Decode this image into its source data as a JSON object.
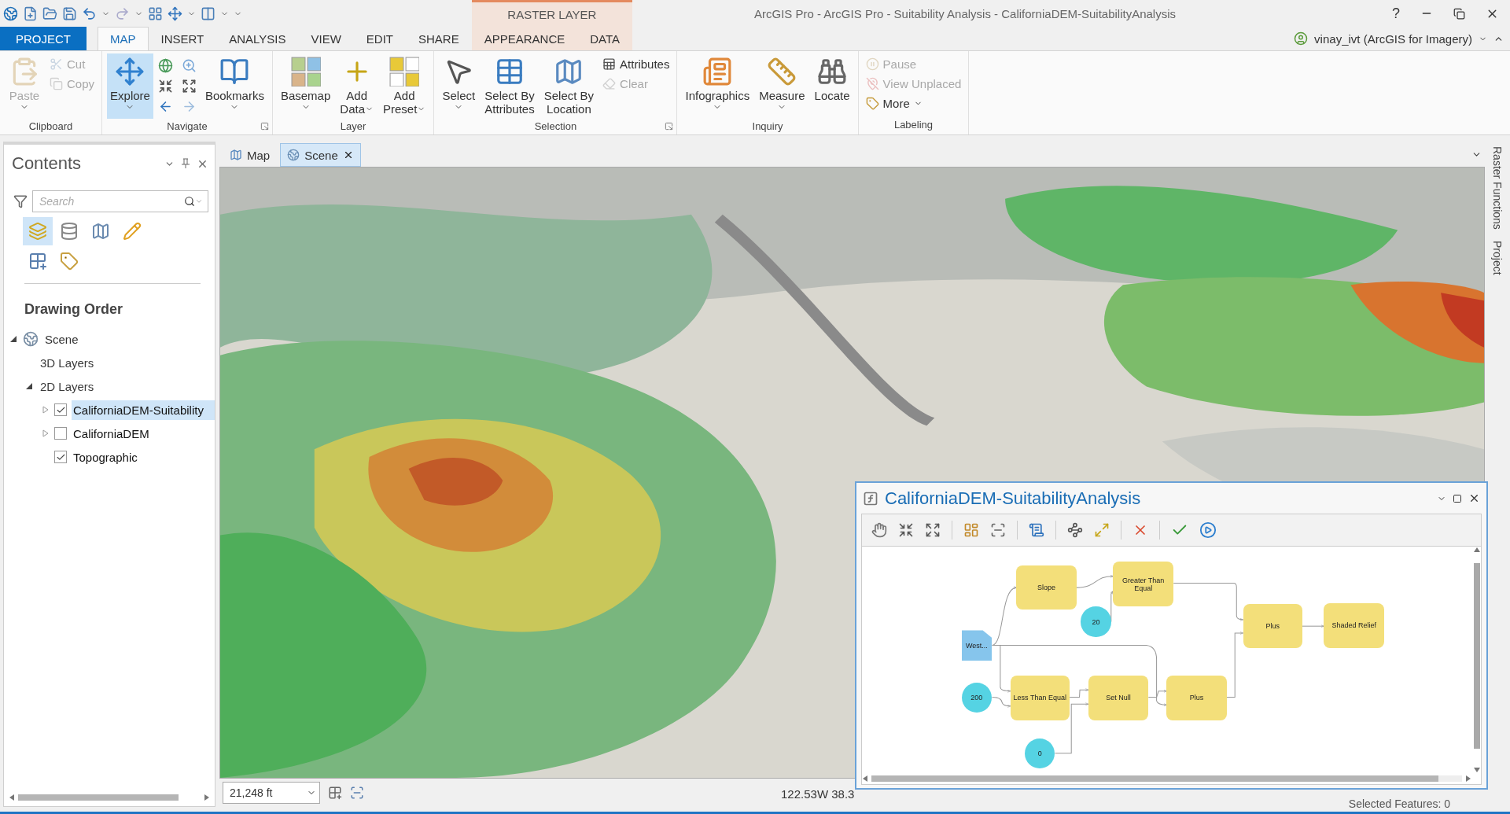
{
  "title_bar": {
    "title": "ArcGIS Pro - ArcGIS Pro - Suitability Analysis - CaliforniaDEM-SuitabilityAnalysis",
    "help": "?",
    "context_label": "RASTER LAYER"
  },
  "tabs": [
    {
      "label": "PROJECT",
      "kind": "backstage",
      "selected": false
    },
    {
      "label": "MAP",
      "kind": "core",
      "selected": true
    },
    {
      "label": "INSERT",
      "kind": "core",
      "selected": false
    },
    {
      "label": "ANALYSIS",
      "kind": "core",
      "selected": false
    },
    {
      "label": "VIEW",
      "kind": "core",
      "selected": false
    },
    {
      "label": "EDIT",
      "kind": "core",
      "selected": false
    },
    {
      "label": "SHARE",
      "kind": "core",
      "selected": false
    },
    {
      "label": "APPEARANCE",
      "kind": "contextual",
      "selected": false
    },
    {
      "label": "DATA",
      "kind": "contextual",
      "selected": false
    }
  ],
  "user": "vinay_ivt (ArcGIS for Imagery)",
  "ribbon": {
    "groups": [
      {
        "label": "Clipboard",
        "launcher": false,
        "items": [
          {
            "kind": "large",
            "lines": [
              "Paste"
            ],
            "dropdown": true,
            "disabled": true,
            "active": false
          },
          {
            "kind": "small",
            "lines": [
              "Cut"
            ],
            "disabled": true,
            "active": false
          },
          {
            "kind": "small",
            "lines": [
              "Copy"
            ],
            "disabled": true,
            "active": false
          }
        ]
      },
      {
        "label": "Navigate",
        "launcher": true,
        "items": [
          {
            "kind": "large",
            "lines": [
              "Explore"
            ],
            "dropdown": true,
            "disabled": false,
            "active": true
          },
          {
            "kind": "icon",
            "disabled": false,
            "active": false
          },
          {
            "kind": "icon",
            "disabled": false,
            "active": false
          },
          {
            "kind": "icon",
            "disabled": false,
            "active": false
          },
          {
            "kind": "icon",
            "disabled": false,
            "active": false
          },
          {
            "kind": "icon",
            "disabled": false,
            "active": false
          },
          {
            "kind": "icon",
            "disabled": true,
            "active": false
          },
          {
            "kind": "large",
            "lines": [
              "Bookmarks"
            ],
            "dropdown": true,
            "disabled": false,
            "active": false
          }
        ]
      },
      {
        "label": "Layer",
        "launcher": false,
        "items": [
          {
            "kind": "large",
            "lines": [
              "Basemap"
            ],
            "dropdown": true,
            "disabled": false,
            "active": false
          },
          {
            "kind": "large",
            "lines": [
              "Add",
              "Data"
            ],
            "dropdown": true,
            "disabled": false,
            "active": false
          },
          {
            "kind": "large",
            "lines": [
              "Add",
              "Preset"
            ],
            "dropdown": true,
            "disabled": false,
            "active": false
          }
        ]
      },
      {
        "label": "Selection",
        "launcher": true,
        "items": [
          {
            "kind": "large",
            "lines": [
              "Select"
            ],
            "dropdown": true,
            "disabled": false,
            "active": false
          },
          {
            "kind": "large",
            "lines": [
              "Select By",
              "Attributes"
            ],
            "disabled": false,
            "active": false
          },
          {
            "kind": "large",
            "lines": [
              "Select By",
              "Location"
            ],
            "disabled": false,
            "active": false
          },
          {
            "kind": "small",
            "lines": [
              "Attributes"
            ],
            "disabled": false,
            "active": false
          },
          {
            "kind": "small",
            "lines": [
              "Clear"
            ],
            "disabled": true,
            "active": false
          }
        ]
      },
      {
        "label": "Inquiry",
        "launcher": false,
        "items": [
          {
            "kind": "large",
            "lines": [
              "Infographics"
            ],
            "dropdown": true,
            "disabled": false,
            "active": false
          },
          {
            "kind": "large",
            "lines": [
              "Measure"
            ],
            "dropdown": true,
            "disabled": false,
            "active": false
          },
          {
            "kind": "large",
            "lines": [
              "Locate"
            ],
            "disabled": false,
            "active": false
          }
        ]
      },
      {
        "label": "Labeling",
        "launcher": false,
        "items": [
          {
            "kind": "small",
            "lines": [
              "Pause"
            ],
            "disabled": true,
            "active": false
          },
          {
            "kind": "small",
            "lines": [
              "View Unplaced"
            ],
            "disabled": true,
            "active": false
          },
          {
            "kind": "small",
            "lines": [
              "More"
            ],
            "dropdown": true,
            "disabled": false,
            "active": false
          }
        ]
      }
    ]
  },
  "contents": {
    "title": "Contents",
    "search": {
      "placeholder": "Search"
    },
    "view_buttons": [
      {
        "selected": true
      },
      {
        "selected": false
      },
      {
        "selected": false
      },
      {
        "selected": false
      },
      {
        "selected": false
      },
      {
        "selected": false
      }
    ],
    "heading": "Drawing Order",
    "tree": [
      {
        "label": "Scene",
        "kind": "scene",
        "expanded": true,
        "selected": false,
        "children": [
          {
            "label": "3D Layers",
            "kind": "group",
            "selected": false
          },
          {
            "label": "2D Layers",
            "kind": "group",
            "expanded": true,
            "selected": false,
            "children": [
              {
                "label": "CaliforniaDEM-Suitability",
                "kind": "layer",
                "expanded": false,
                "checked": true,
                "selected": true
              },
              {
                "label": "CaliforniaDEM",
                "kind": "layer",
                "expanded": false,
                "checked": false,
                "selected": false
              },
              {
                "label": "Topographic",
                "kind": "layer",
                "checked": true,
                "selected": false
              }
            ]
          }
        ]
      }
    ]
  },
  "view_tabs": [
    {
      "label": "Map",
      "kind": "map",
      "selected": false,
      "closable": false
    },
    {
      "label": "Scene",
      "kind": "scene",
      "selected": true,
      "closable": true
    }
  ],
  "status_bar": {
    "scale": "21,248 ft",
    "coordinates": "122.53W 38.3",
    "selected_features": "Selected Features: 0"
  },
  "side_tabs": [
    {
      "label": "Raster Functions"
    },
    {
      "label": "Project"
    }
  ],
  "function_editor": {
    "title": "CaliforniaDEM-SuitabilityAnalysis",
    "nodes": [
      {
        "kind": "function",
        "label": "Slope"
      },
      {
        "kind": "function",
        "label": "Greater Than Equal"
      },
      {
        "kind": "value",
        "label": "20"
      },
      {
        "kind": "function",
        "label": "Plus"
      },
      {
        "kind": "function",
        "label": "Shaded Relief"
      },
      {
        "kind": "raster",
        "label": "West..."
      },
      {
        "kind": "value",
        "label": "200"
      },
      {
        "kind": "function",
        "label": "Less Than Equal"
      },
      {
        "kind": "function",
        "label": "Set Null"
      },
      {
        "kind": "function",
        "label": "Plus"
      },
      {
        "kind": "value",
        "label": "0"
      }
    ]
  }
}
